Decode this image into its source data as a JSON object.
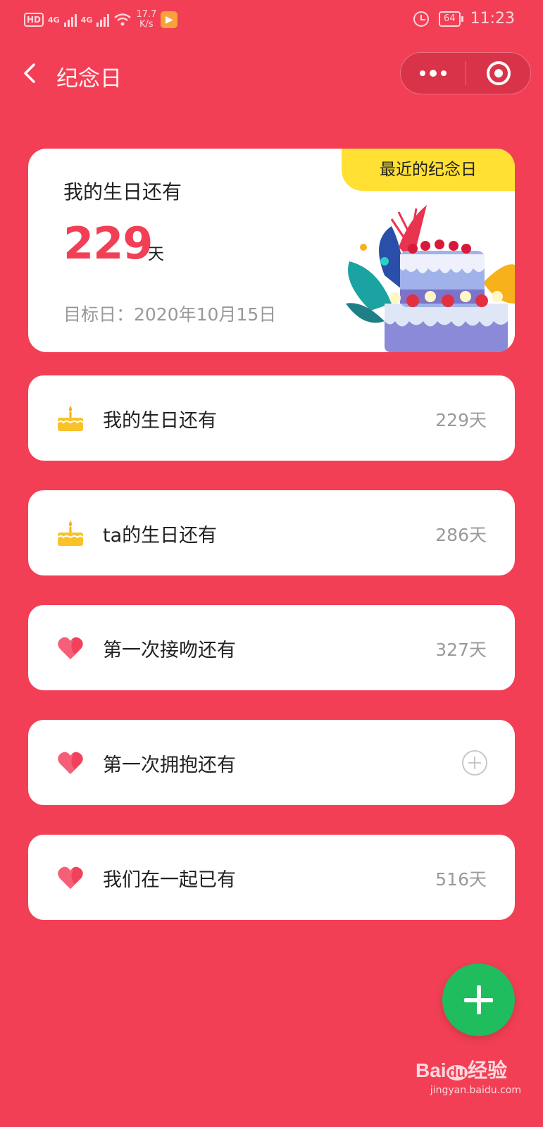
{
  "status_bar": {
    "hd": "HD",
    "hd_sub": "2",
    "net1": "4G",
    "net2": "4G",
    "speed_value": "17.7",
    "speed_unit": "K/s",
    "battery": "64",
    "time": "11:23"
  },
  "nav": {
    "title": "纪念日"
  },
  "hero": {
    "badge": "最近的纪念日",
    "label": "我的生日还有",
    "count": "229",
    "unit": "天",
    "target_date": "目标日：2020年10月15日"
  },
  "events": [
    {
      "icon": "cake-icon",
      "label": "我的生日还有",
      "days": "229天"
    },
    {
      "icon": "cake-icon",
      "label": "ta的生日还有",
      "days": "286天"
    },
    {
      "icon": "heart-icon",
      "label": "第一次接吻还有",
      "days": "327天"
    },
    {
      "icon": "heart-icon",
      "label": "第一次拥抱还有",
      "days": ""
    },
    {
      "icon": "heart-icon",
      "label": "我们在一起已有",
      "days": "516天"
    }
  ],
  "watermark": {
    "logo_left": "Bai",
    "logo_mid": "du",
    "logo_right": "经验",
    "site": "jingyan.baidu.com"
  },
  "colors": {
    "background": "#f23f55",
    "accent": "#f23f55",
    "badge": "#ffe033",
    "fab": "#1fbd5e"
  }
}
